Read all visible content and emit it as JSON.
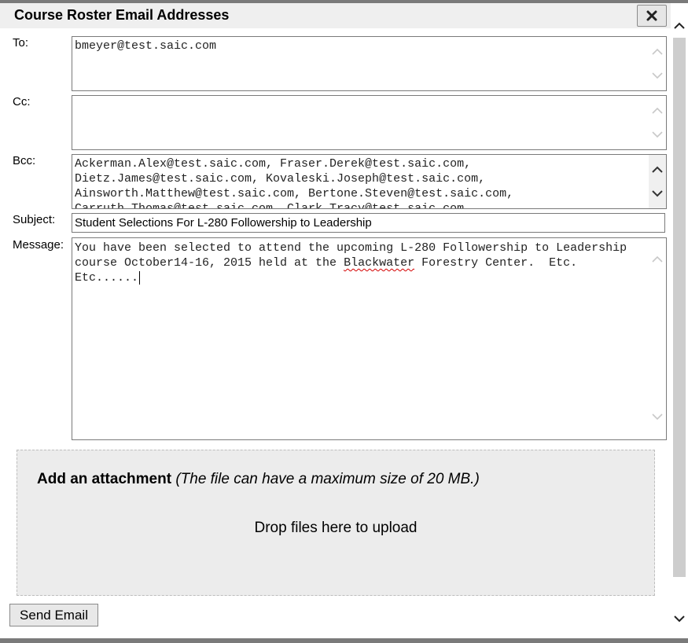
{
  "dialog": {
    "title": "Course Roster Email Addresses"
  },
  "labels": {
    "to": "To:",
    "cc": "Cc:",
    "bcc": "Bcc:",
    "subject": "Subject:",
    "message": "Message:"
  },
  "fields": {
    "to": "bmeyer@test.saic.com",
    "cc": "",
    "bcc": "Ackerman.Alex@test.saic.com, Fraser.Derek@test.saic.com, Dietz.James@test.saic.com, Kovaleski.Joseph@test.saic.com, Ainsworth.Matthew@test.saic.com, Bertone.Steven@test.saic.com, Carruth.Thomas@test.saic.com, Clark.Tracy@test.saic.com",
    "subject": "Student Selections For L-280 Followership to Leadership",
    "message_part1": "You have been selected to attend the upcoming L-280 Followership to Leadership course October14-16, 2015 held at the ",
    "message_misspelled": "Blackwater",
    "message_part2": " Forestry Center.  Etc. Etc......"
  },
  "attachment": {
    "heading": "Add an attachment",
    "note": "(The file can have a maximum size of 20 MB.)",
    "drop_text": "Drop files here to upload"
  },
  "actions": {
    "send": "Send Email"
  },
  "icons": {
    "close": "close-x-icon",
    "scroll_up": "chevron-up-icon",
    "scroll_down": "chevron-down-icon"
  }
}
